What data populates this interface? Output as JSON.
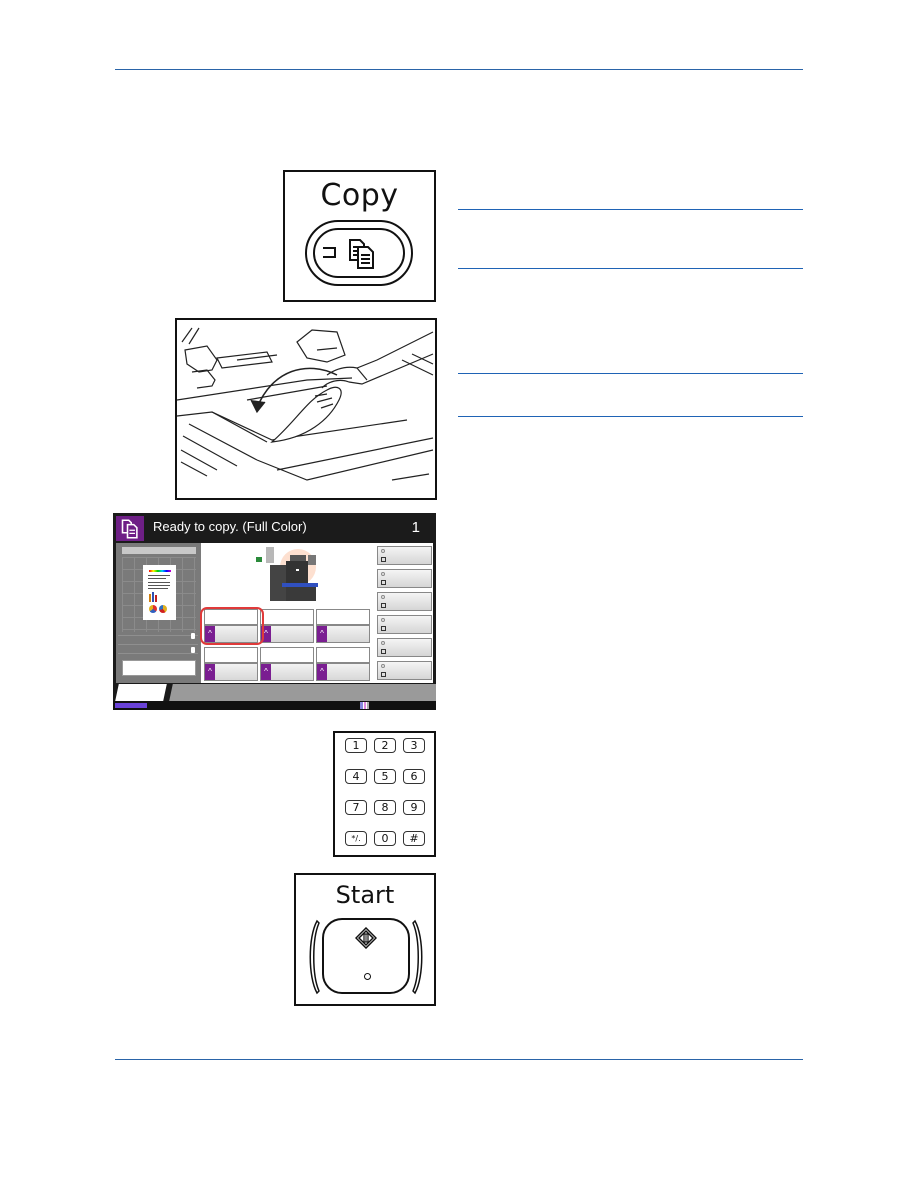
{
  "document": {
    "colors": {
      "rule": "#2a64a8",
      "note_rule": "#1f63b5",
      "screen_accent": "#6e1f86",
      "highlight": "#e03a3a",
      "progress": "#6a42d8"
    }
  },
  "copy_key": {
    "label": "Copy",
    "icon": "copy-documents-icon",
    "indicator": "copy-led-icon"
  },
  "original_placement": {
    "illustration": "placing-original-on-platen",
    "icon": "curved-arrow-icon"
  },
  "touch_screen": {
    "status_title": "Ready to copy. (Full Color)",
    "copies": "1",
    "header_icon": "copy-mode-icon",
    "preview_icon": "document-preview-icon",
    "machine_icon": "mfp-machine-icon",
    "highlighted_tile_index": 0,
    "tiles": [
      {
        "label": "",
        "chevron": "^"
      },
      {
        "label": "",
        "chevron": "^"
      },
      {
        "label": "",
        "chevron": "^"
      },
      {
        "label": "",
        "chevron": "^"
      },
      {
        "label": "",
        "chevron": "^"
      },
      {
        "label": "",
        "chevron": "^"
      }
    ],
    "side_buttons": [
      {
        "label": ""
      },
      {
        "label": ""
      },
      {
        "label": ""
      },
      {
        "label": ""
      },
      {
        "label": ""
      },
      {
        "label": ""
      }
    ],
    "tabs": [
      {
        "label": "",
        "active": true
      },
      {
        "label": "",
        "active": false
      },
      {
        "label": "",
        "active": false
      },
      {
        "label": "",
        "active": false
      },
      {
        "label": "",
        "active": false
      },
      {
        "label": "",
        "active": false
      }
    ],
    "progress_fraction": 0.1
  },
  "keypad": {
    "keys": [
      "1",
      "2",
      "3",
      "4",
      "5",
      "6",
      "7",
      "8",
      "9",
      "*/.",
      "0",
      "#"
    ]
  },
  "start_key": {
    "label": "Start",
    "icon": "start-diamond-icon",
    "indicator": "start-led-icon"
  }
}
